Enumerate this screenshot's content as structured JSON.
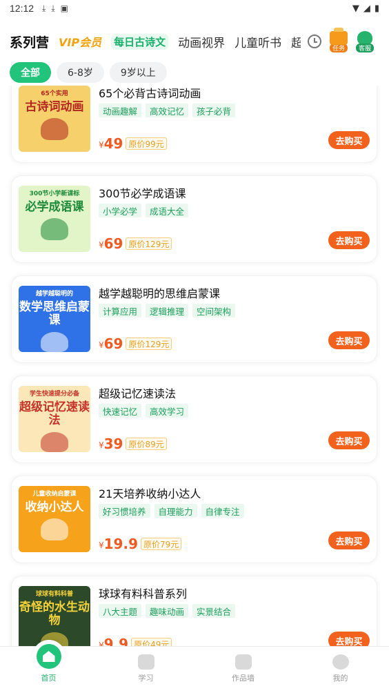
{
  "status_bar": {
    "time": "12:12",
    "icons": [
      "download-icon",
      "download-icon",
      "a-icon"
    ],
    "right_icons": [
      "wifi-icon",
      "signal-icon",
      "battery-icon"
    ]
  },
  "top_nav": {
    "tabs": [
      "系列营",
      "VIP会员",
      "每日古诗文",
      "动画视界",
      "儿童听书",
      "超"
    ],
    "history_icon": "clock-icon",
    "task_label": "任务",
    "kefu_label": "客服"
  },
  "filters": [
    "全部",
    "6-8岁",
    "9岁以上"
  ],
  "courses": [
    {
      "title": "65个必背古诗词动画",
      "tags": [
        "动画趣解",
        "高效记忆",
        "孩子必背"
      ],
      "yen": "¥",
      "price": "49",
      "original": "原价99元",
      "buy": "去购买",
      "thumb": {
        "line1": "65个实用",
        "line2": "古诗词动画",
        "bg": "#f6d06b",
        "fg": "#b3261e"
      }
    },
    {
      "title": "300节必学成语课",
      "tags": [
        "小学必学",
        "成语大全"
      ],
      "yen": "¥",
      "price": "69",
      "original": "原价129元",
      "buy": "去购买",
      "thumb": {
        "line1": "300节小学新课标",
        "line2": "必学成语课",
        "bg": "#e2f5c8",
        "fg": "#1d8a3a"
      }
    },
    {
      "title": "越学越聪明的思维启蒙课",
      "tags": [
        "计算应用",
        "逻辑推理",
        "空间架构"
      ],
      "yen": "¥",
      "price": "69",
      "original": "原价129元",
      "buy": "去购买",
      "thumb": {
        "line1": "越学越聪明的",
        "line2": "数学思维启蒙课",
        "bg": "#2f72e8",
        "fg": "#ffffff"
      }
    },
    {
      "title": "超级记忆速读法",
      "tags": [
        "快速记忆",
        "高效学习"
      ],
      "yen": "¥",
      "price": "39",
      "original": "原价89元",
      "buy": "去购买",
      "thumb": {
        "line1": "学生快速提分必备",
        "line2": "超级记忆速读法",
        "bg": "#fbe7b8",
        "fg": "#c4342a"
      }
    },
    {
      "title": "21天培养收纳小达人",
      "tags": [
        "好习惯培养",
        "自理能力",
        "自律专注"
      ],
      "yen": "¥",
      "price": "19.9",
      "original": "原价79元",
      "buy": "去购买",
      "thumb": {
        "line1": "儿童收纳启蒙课",
        "line2": "收纳小达人",
        "bg": "#f7a21b",
        "fg": "#ffffff"
      }
    },
    {
      "title": "球球有料科普系列",
      "tags": [
        "八大主题",
        "趣味动画",
        "实景结合"
      ],
      "yen": "¥",
      "price": "9.9",
      "original": "原价49元",
      "buy": "去购买",
      "thumb": {
        "line1": "球球有料科普",
        "line2": "奇怪的水生动物",
        "bg": "#2c4a2a",
        "fg": "#f5d23a"
      }
    }
  ],
  "bottom_nav": [
    {
      "label": "首页",
      "icon": "home-icon"
    },
    {
      "label": "学习",
      "icon": "tv-icon"
    },
    {
      "label": "作品墙",
      "icon": "picture-icon"
    },
    {
      "label": "我的",
      "icon": "profile-icon"
    }
  ]
}
